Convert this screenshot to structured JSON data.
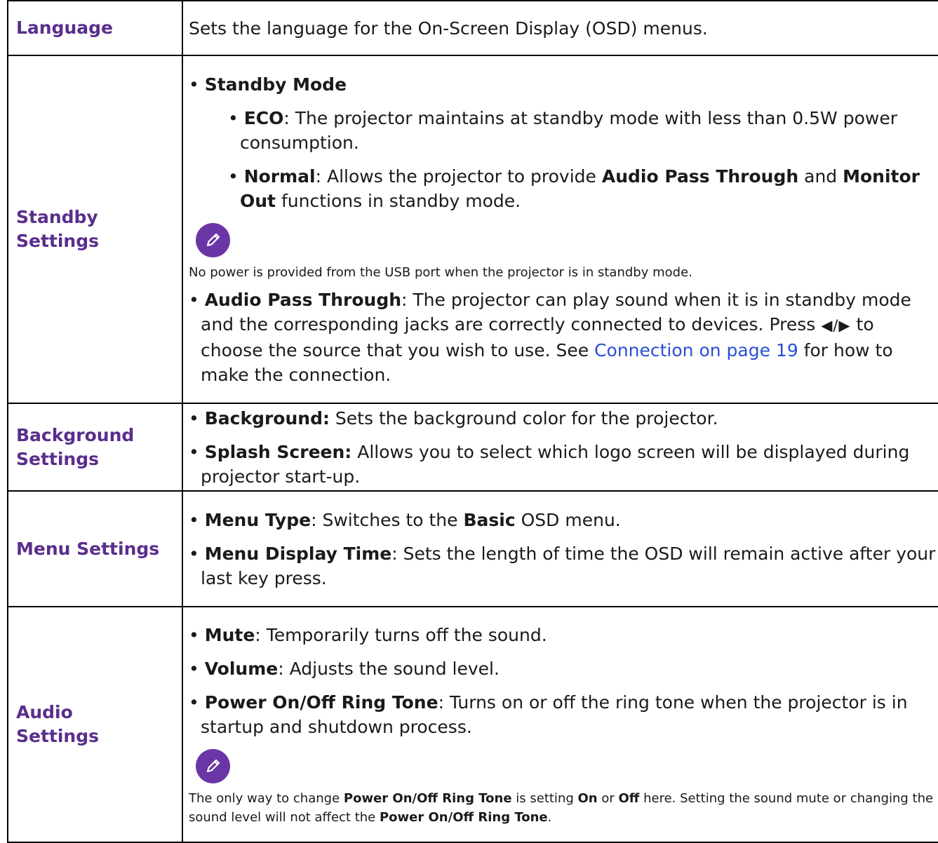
{
  "rows": [
    {
      "label": "Language",
      "text": "Sets the language for the On-Screen Display (OSD) menus."
    },
    {
      "label_line1": "Standby",
      "label_line2": "Settings",
      "standby_mode": {
        "bullet": "•",
        "title": "Standby Mode",
        "eco_term": "ECO",
        "eco_text": ": The projector maintains at standby mode with less than 0.5W power consumption.",
        "normal_term": "Normal",
        "normal_text_a": ": Allows the projector to provide ",
        "normal_bold_a": "Audio Pass Through",
        "normal_text_b": " and ",
        "normal_bold_b": "Monitor Out",
        "normal_text_c": " functions in standby mode."
      },
      "note_icon": "pencil-note-icon",
      "note": "No power is provided from the USB port when the projector is in standby mode.",
      "audio_pass": {
        "term": "Audio Pass Through",
        "text_a": ": The projector can play sound when it is in standby mode and the corresponding jacks are correctly connected to devices. Press ",
        "arrows": "◀/▶",
        "text_b": " to choose the source that you wish to use. See ",
        "link": "Connection on page 19",
        "text_c": " for how to make the connection."
      }
    },
    {
      "label_line1": "Background",
      "label_line2": "Settings",
      "background_term": "Background:",
      "background_text": " Sets the background color for the projector.",
      "splash_term": "Splash Screen:",
      "splash_text": " Allows you to select which logo screen will be displayed during projector start-up."
    },
    {
      "label": "Menu Settings",
      "menu_type_term": "Menu Type",
      "menu_type_text_a": ": Switches to the ",
      "menu_type_bold": "Basic",
      "menu_type_text_b": " OSD menu.",
      "display_time_term": "Menu Display Time",
      "display_time_text": ": Sets the length of time the OSD will remain active after your last key press."
    },
    {
      "label_line1": "Audio",
      "label_line2": "Settings",
      "mute_term": "Mute",
      "mute_text": ": Temporarily turns off the sound.",
      "volume_term": "Volume",
      "volume_text": ": Adjusts the sound level.",
      "ring_term": "Power On/Off Ring Tone",
      "ring_text": ": Turns on or off the ring tone when the projector is in startup and shutdown process.",
      "note_icon": "pencil-note-icon",
      "note_a": "The only way to change ",
      "note_b": "Power On/Off Ring Tone",
      "note_c": " is setting ",
      "note_d": "On",
      "note_e": " or ",
      "note_f": "Off",
      "note_g": " here. Setting the sound mute or changing the sound level will not affect the ",
      "note_h": "Power On/Off Ring Tone",
      "note_i": "."
    }
  ],
  "colors": {
    "label": "#5a2e8c",
    "note_icon": "#6a35a5",
    "link": "#2a4fd6",
    "border": "#000000"
  }
}
